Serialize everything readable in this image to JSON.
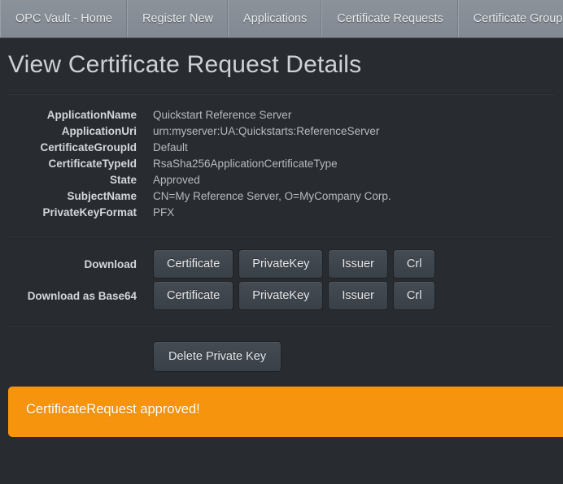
{
  "nav": {
    "tabs": [
      {
        "label": "OPC Vault - Home"
      },
      {
        "label": "Register New"
      },
      {
        "label": "Applications"
      },
      {
        "label": "Certificate Requests"
      },
      {
        "label": "Certificate Groups"
      }
    ]
  },
  "page": {
    "title": "View Certificate Request Details"
  },
  "details": [
    {
      "label": "ApplicationName",
      "value": "Quickstart Reference Server"
    },
    {
      "label": "ApplicationUri",
      "value": "urn:myserver:UA:Quickstarts:ReferenceServer"
    },
    {
      "label": "CertificateGroupId",
      "value": "Default"
    },
    {
      "label": "CertificateTypeId",
      "value": "RsaSha256ApplicationCertificateType"
    },
    {
      "label": "State",
      "value": "Approved"
    },
    {
      "label": "SubjectName",
      "value": "CN=My Reference Server, O=MyCompany Corp."
    },
    {
      "label": "PrivateKeyFormat",
      "value": "PFX"
    }
  ],
  "downloads": {
    "rows": [
      {
        "label": "Download",
        "buttons": [
          {
            "label": "Certificate"
          },
          {
            "label": "PrivateKey"
          },
          {
            "label": "Issuer"
          },
          {
            "label": "Crl"
          }
        ]
      },
      {
        "label": "Download as Base64",
        "buttons": [
          {
            "label": "Certificate"
          },
          {
            "label": "PrivateKey"
          },
          {
            "label": "Issuer"
          },
          {
            "label": "Crl"
          }
        ]
      }
    ]
  },
  "actions": {
    "delete_private_key_label": "Delete Private Key"
  },
  "alert": {
    "message": "CertificateRequest approved!",
    "color": "#f6940d"
  },
  "colors": {
    "page_background": "#282c30",
    "navbar_background": "#868d96",
    "button_background": "#3e444c",
    "accent": "#f6940d"
  }
}
